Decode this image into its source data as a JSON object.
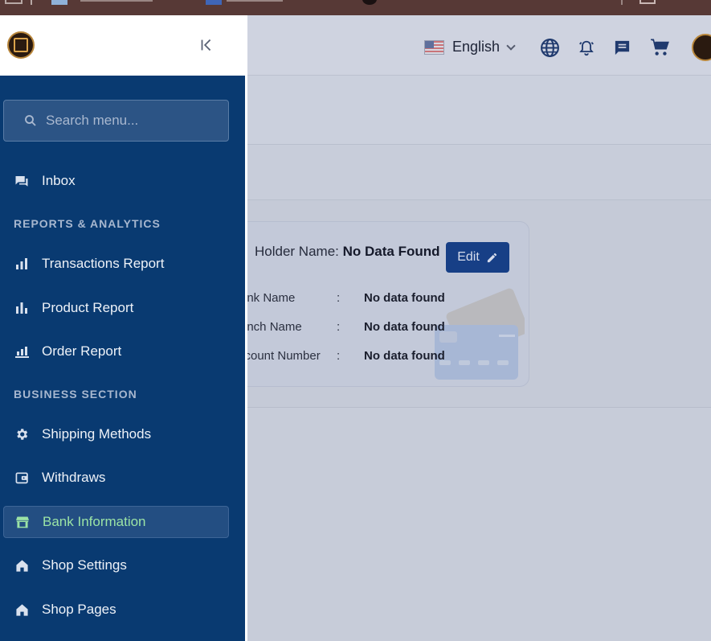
{
  "header": {
    "language": "English"
  },
  "bank_card": {
    "holder_label": "Holder Name:",
    "holder_value": "No Data Found",
    "edit_label": "Edit",
    "rows": [
      {
        "label": "ank Name",
        "sep": ":",
        "value": "No data found"
      },
      {
        "label": "anch Name",
        "sep": ":",
        "value": "No data found"
      },
      {
        "label": "ccount Number",
        "sep": ":",
        "value": "No data found"
      }
    ]
  },
  "sidebar": {
    "search_placeholder": "Search menu...",
    "inbox": "Inbox",
    "section_reports": "REPORTS & ANALYTICS",
    "transactions_report": "Transactions Report",
    "product_report": "Product Report",
    "order_report": "Order Report",
    "section_business": "BUSINESS SECTION",
    "shipping_methods": "Shipping Methods",
    "withdraws": "Withdraws",
    "bank_information": "Bank Information",
    "shop_settings": "Shop Settings",
    "shop_pages": "Shop Pages",
    "active_item": "Bank Information"
  },
  "colors": {
    "sidebar_bg": "#093a71",
    "active_label": "#9be3a5",
    "edit_button": "#173f86"
  },
  "icons": {
    "inbox": "inbox-icon",
    "transactions": "bar-chart-icon",
    "product": "bar-chart-icon",
    "order": "bar-chart-icon",
    "shipping": "gear-icon",
    "withdraws": "wallet-icon",
    "bank": "bank-icon",
    "shop_settings": "home-icon",
    "shop_pages": "home-icon"
  }
}
